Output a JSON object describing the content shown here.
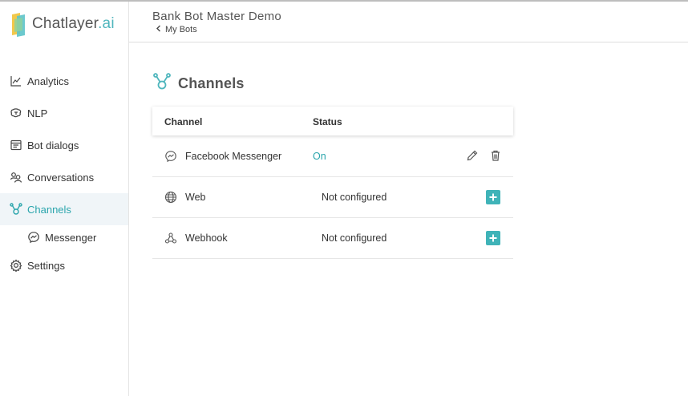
{
  "brand": {
    "name": "Chatlayer",
    "suffix": ".ai",
    "accent": "#2aa5ac"
  },
  "header": {
    "title": "Bank Bot Master Demo",
    "back_label": "My Bots"
  },
  "sidebar": {
    "items": [
      {
        "label": "Analytics",
        "icon": "chart-line-icon"
      },
      {
        "label": "NLP",
        "icon": "brain-icon"
      },
      {
        "label": "Bot dialogs",
        "icon": "dialog-icon"
      },
      {
        "label": "Conversations",
        "icon": "users-icon"
      },
      {
        "label": "Channels",
        "icon": "channels-icon",
        "active": true
      },
      {
        "label": "Messenger",
        "icon": "messenger-icon",
        "sub": true
      },
      {
        "label": "Settings",
        "icon": "gear-icon"
      }
    ]
  },
  "main": {
    "title": "Channels",
    "table": {
      "headers": [
        "Channel",
        "Status"
      ],
      "rows": [
        {
          "name": "Facebook Messenger",
          "status": "On",
          "icon": "messenger-icon"
        },
        {
          "name": "Web",
          "status": "Not configured",
          "icon": "globe-icon"
        },
        {
          "name": "Webhook",
          "status": "Not configured",
          "icon": "webhook-icon"
        }
      ]
    }
  }
}
